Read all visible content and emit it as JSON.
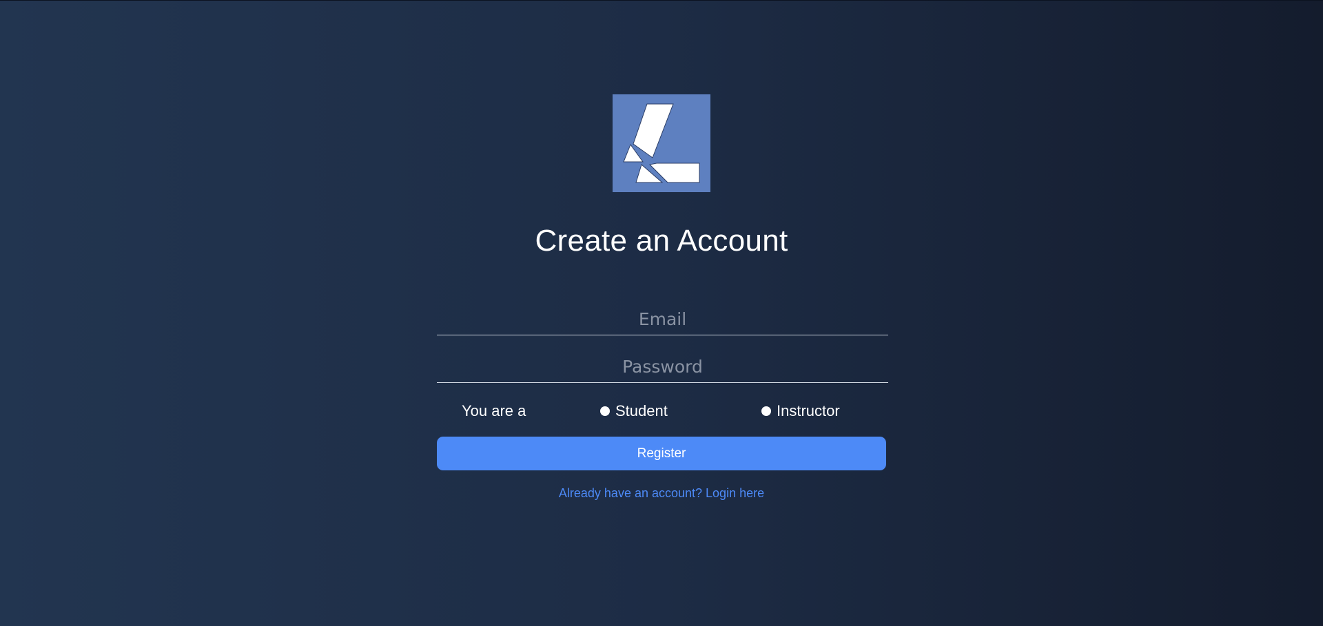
{
  "page": {
    "title": "Create an Account"
  },
  "form": {
    "email_placeholder": "Email",
    "email_value": "",
    "password_placeholder": "Password",
    "password_value": "",
    "role_label": "You are a",
    "role_options": [
      {
        "label": "Student"
      },
      {
        "label": "Instructor"
      }
    ],
    "register_label": "Register",
    "login_link": "Already have an account? Login here"
  },
  "colors": {
    "background_left": "#223550",
    "background_right": "#141c2d",
    "logo_bg": "#5e80c0",
    "accent": "#4d8af7"
  },
  "icons": {
    "logo": "brand-logo-icon",
    "radio": "radio-dot-icon"
  }
}
